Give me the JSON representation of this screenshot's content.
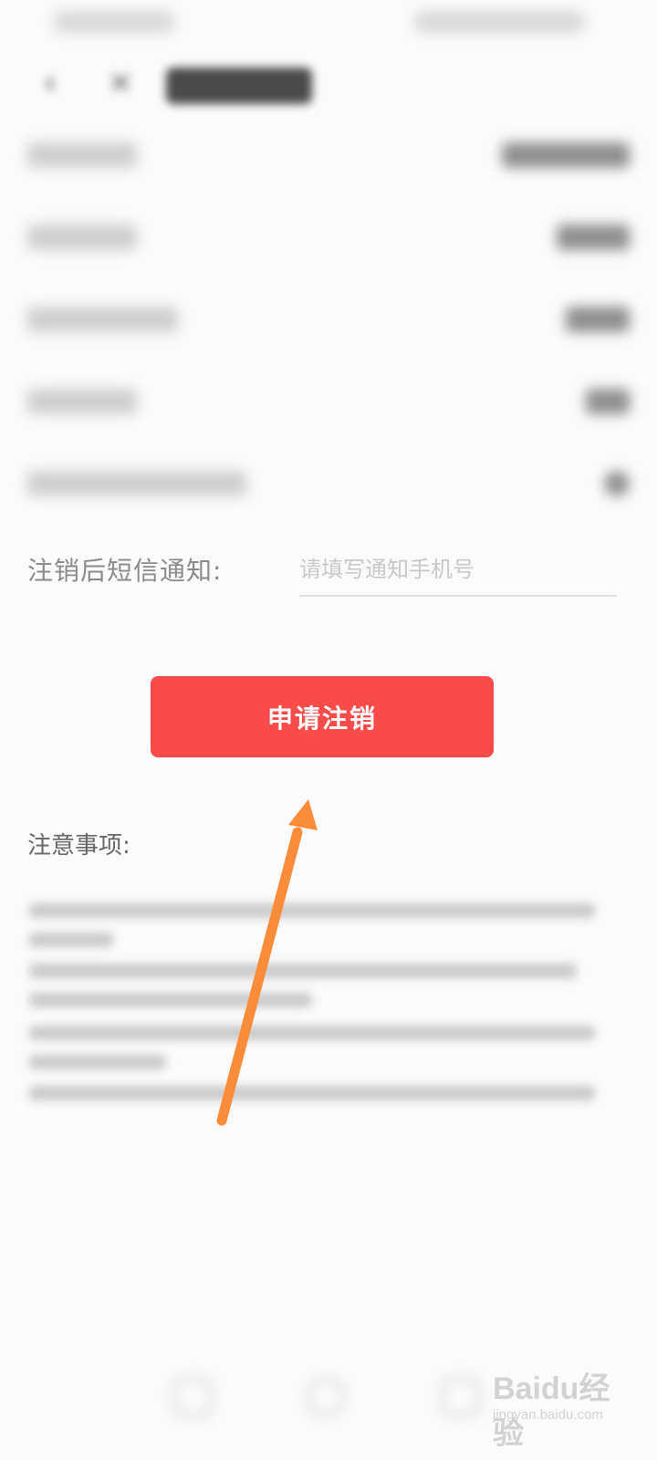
{
  "accent_color": "#fa4b4b",
  "arrow_color": "#fa8c3a",
  "nav": {
    "back_icon": "chevron-left-icon",
    "close_icon": "close-icon"
  },
  "sms_notice": {
    "label": "注销后短信通知:",
    "placeholder": "请填写通知手机号",
    "value": ""
  },
  "apply_button": {
    "label": "申请注销"
  },
  "notes": {
    "title": "注意事项:"
  },
  "watermark": {
    "logo": "Baidu经验",
    "sub": "jingyan.baidu.com"
  }
}
